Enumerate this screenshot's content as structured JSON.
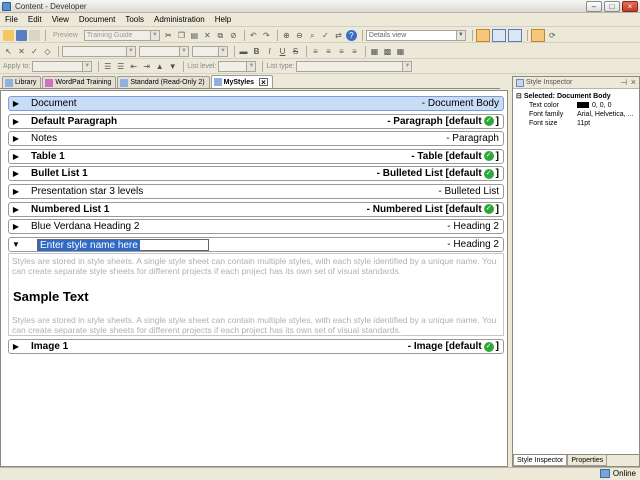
{
  "window": {
    "title": "Content - Developer"
  },
  "menu": [
    "File",
    "Edit",
    "View",
    "Document",
    "Tools",
    "Administration",
    "Help"
  ],
  "toolbar1": {
    "preview_label": "Preview",
    "preview_combo": "Training Guide",
    "view_combo": "Details view"
  },
  "toolbar3": {
    "apply_to_label": "Apply to:",
    "list_level_label": "List level:",
    "list_type_label": "List type:"
  },
  "doc_tabs": [
    {
      "label": "Library"
    },
    {
      "label": "WordPad Training"
    },
    {
      "label": "Standard (Read-Only 2)"
    },
    {
      "label": "MyStyles",
      "active": true
    }
  ],
  "styles": [
    {
      "name": "Document",
      "type": "- Document Body",
      "bold": false,
      "default": false,
      "selected": true
    },
    {
      "name": "Default Paragraph",
      "type": "- Paragraph [default",
      "bold": true,
      "default": true
    },
    {
      "name": "Notes",
      "type": "- Paragraph",
      "bold": false,
      "default": false
    },
    {
      "name": "Table 1",
      "type": "- Table [default",
      "bold": true,
      "default": true
    },
    {
      "name": "Bullet List 1",
      "type": "- Bulleted List [default",
      "bold": true,
      "default": true
    },
    {
      "name": "Presentation star 3 levels",
      "type": "- Bulleted List",
      "bold": false,
      "default": false
    },
    {
      "name": "Numbered List 1",
      "type": "- Numbered List [default",
      "bold": true,
      "default": true
    },
    {
      "name": "Blue Verdana Heading 2",
      "type": "- Heading 2",
      "bold": false,
      "default": false
    }
  ],
  "editing_row": {
    "name": "Enter style name here",
    "type": "- Heading 2"
  },
  "preview": {
    "paragraph": "Styles are stored in style sheets. A single style sheet can contain multiple styles, with each style identified by a unique name. You can create separate style sheets for different projects if each project has its own set of visual standards.",
    "heading": "Sample Text"
  },
  "last_row": {
    "name": "Image 1",
    "type": "- Image [default",
    "bold": true,
    "default": true
  },
  "default_suffix": "]",
  "inspector": {
    "title": "Style Inspector",
    "selected": "Selected: Document Body",
    "props": [
      {
        "key": "Text color",
        "value": "0, 0, 0"
      },
      {
        "key": "Font family",
        "value": "Arial, Helvetica, ..."
      },
      {
        "key": "Font size",
        "value": "11pt"
      }
    ],
    "tabs": [
      "Style Inspector",
      "Properties"
    ]
  },
  "status": {
    "text": "Online"
  },
  "colors": {
    "selected_row": "#c9dcf6",
    "check": "#2fa83a",
    "highlight": "#316ac5"
  }
}
